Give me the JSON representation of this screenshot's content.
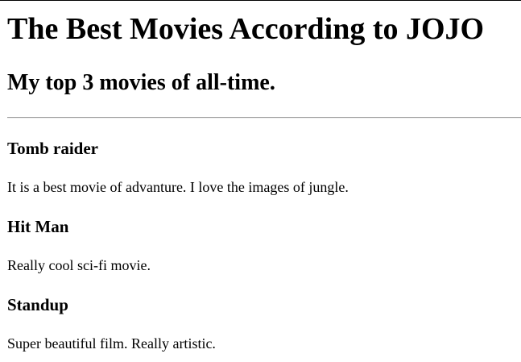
{
  "page": {
    "title": "The Best Movies According to JOJO",
    "subtitle": "My top 3 movies of all-time."
  },
  "movies": [
    {
      "name": "Tomb raider",
      "description": "It is a best movie of advanture. I love the images of jungle."
    },
    {
      "name": "Hit Man",
      "description": "Really cool sci-fi movie."
    },
    {
      "name": "Standup",
      "description": "Super beautiful film. Really artistic."
    }
  ]
}
